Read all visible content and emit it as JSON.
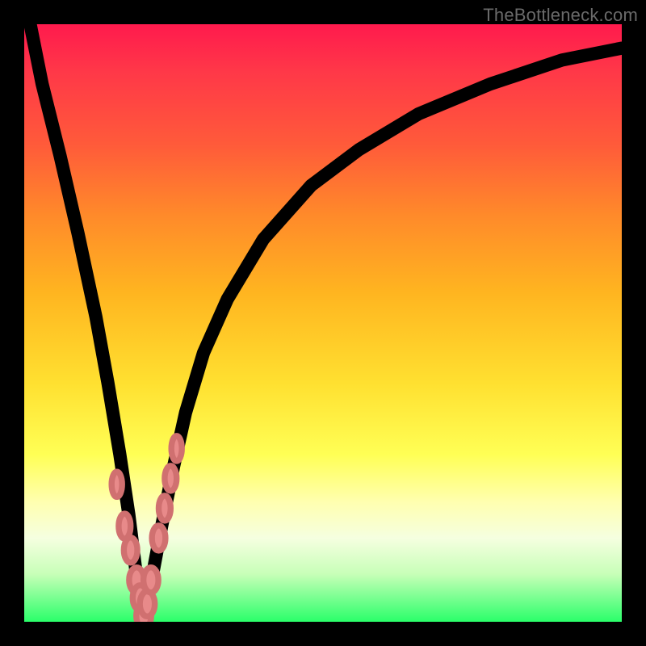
{
  "watermark": "TheBottleneck.com",
  "chart_data": {
    "type": "line",
    "title": "",
    "xlabel": "",
    "ylabel": "",
    "xlim": [
      0,
      100
    ],
    "ylim": [
      0,
      100
    ],
    "series": [
      {
        "name": "bottleneck-curve",
        "x": [
          1,
          3,
          6,
          9,
          12,
          14,
          16,
          17.5,
          18.5,
          19,
          19.5,
          20,
          20.5,
          21.5,
          23,
          25,
          27,
          30,
          34,
          40,
          48,
          56,
          66,
          78,
          90,
          100
        ],
        "y": [
          100,
          90,
          78,
          65,
          51,
          40,
          28,
          18,
          10,
          6,
          3,
          1,
          3,
          8,
          16,
          26,
          35,
          45,
          54,
          64,
          73,
          79,
          85,
          90,
          94,
          96
        ]
      }
    ],
    "markers": {
      "name": "highlighted-range",
      "x": [
        15.5,
        16.8,
        17.8,
        18.8,
        19.4,
        20.0,
        20.6,
        21.2,
        22.5,
        23.5,
        24.5,
        25.5
      ],
      "y": [
        23,
        16,
        12,
        7,
        4,
        1,
        3,
        7,
        14,
        19,
        24,
        29
      ],
      "rx": [
        3.5,
        4.0,
        4.5,
        5.0,
        5.0,
        5.0,
        5.0,
        5.0,
        4.5,
        4.0,
        4.0,
        3.5
      ],
      "ry": [
        6,
        6,
        6,
        6,
        6,
        6,
        6,
        6,
        6,
        6,
        6,
        6
      ]
    },
    "gradient_stops": [
      {
        "pos": 0,
        "color": "#ff1a4d"
      },
      {
        "pos": 8,
        "color": "#ff3848"
      },
      {
        "pos": 20,
        "color": "#ff5a3a"
      },
      {
        "pos": 32,
        "color": "#ff8a2a"
      },
      {
        "pos": 45,
        "color": "#ffb520"
      },
      {
        "pos": 60,
        "color": "#ffe030"
      },
      {
        "pos": 72,
        "color": "#ffff55"
      },
      {
        "pos": 80,
        "color": "#ffffb0"
      },
      {
        "pos": 86,
        "color": "#f5ffe0"
      },
      {
        "pos": 92,
        "color": "#c8ffb8"
      },
      {
        "pos": 100,
        "color": "#2aff6a"
      }
    ]
  }
}
